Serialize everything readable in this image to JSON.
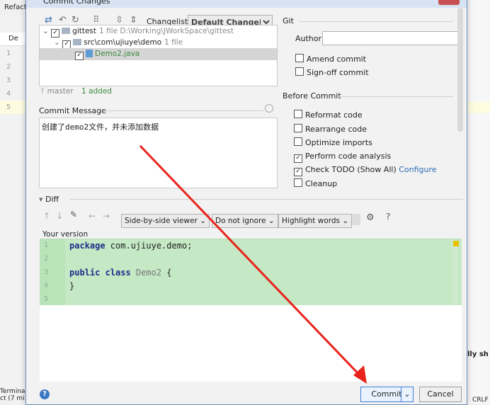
{
  "window": {
    "title": "Commit Changes"
  },
  "ide": {
    "menu_item": "Refacto",
    "tab_label": "De",
    "line_numbers": [
      "1",
      "2",
      "3",
      "4",
      "5"
    ],
    "terminal_label": "Terminal",
    "status_text": "ct (7 mi",
    "right_clip_text": "lly sh",
    "cpu_text": "CRLF"
  },
  "toolbar": {
    "changelist_label": "Changelist:",
    "changelist_value": "Default Changelist"
  },
  "tree": {
    "root": {
      "name": "gittest",
      "meta": "1 file  D:\\Working\\JWorkSpace\\gittest"
    },
    "folder": {
      "name": "src\\com\\ujiuye\\demo",
      "meta": "1 file"
    },
    "file": {
      "name": "Demo2.java"
    }
  },
  "branch": {
    "name": "master",
    "status": "1 added"
  },
  "commit_message": {
    "label": "Commit Message",
    "text": "创建了demo2文件，并未添加数据"
  },
  "git_section": {
    "title": "Git",
    "author_label": "Author:",
    "author_value": "",
    "amend_label": "Amend commit",
    "signoff_label": "Sign-off commit"
  },
  "before_commit": {
    "title": "Before Commit",
    "options": [
      {
        "label": "Reformat code",
        "checked": false
      },
      {
        "label": "Rearrange code",
        "checked": false
      },
      {
        "label": "Optimize imports",
        "checked": false
      },
      {
        "label": "Perform code analysis",
        "checked": true
      },
      {
        "label": "Check TODO (Show All)",
        "checked": true,
        "link": "Configure"
      },
      {
        "label": "Cleanup",
        "checked": false
      }
    ]
  },
  "diff": {
    "title": "Diff",
    "viewer": "Side-by-side viewer",
    "whitespace": "Do not ignore",
    "highlight": "Highlight words",
    "your_version": "Your version",
    "lines": [
      {
        "n": "1",
        "kw": "package",
        "rest": " com.ujiuye.demo;"
      },
      {
        "n": "2",
        "kw": "",
        "rest": ""
      },
      {
        "n": "3",
        "kw": "public class",
        "cls": " Demo2",
        "rest": " {"
      },
      {
        "n": "4",
        "kw": "",
        "rest": "}"
      },
      {
        "n": "5",
        "kw": "",
        "rest": ""
      }
    ]
  },
  "buttons": {
    "commit": "Commit",
    "cancel": "Cancel",
    "help": "?"
  },
  "colors": {
    "accent": "#3c7fd6",
    "diff_added_bg": "#c5e8c5",
    "arrow": "#e8231b"
  }
}
